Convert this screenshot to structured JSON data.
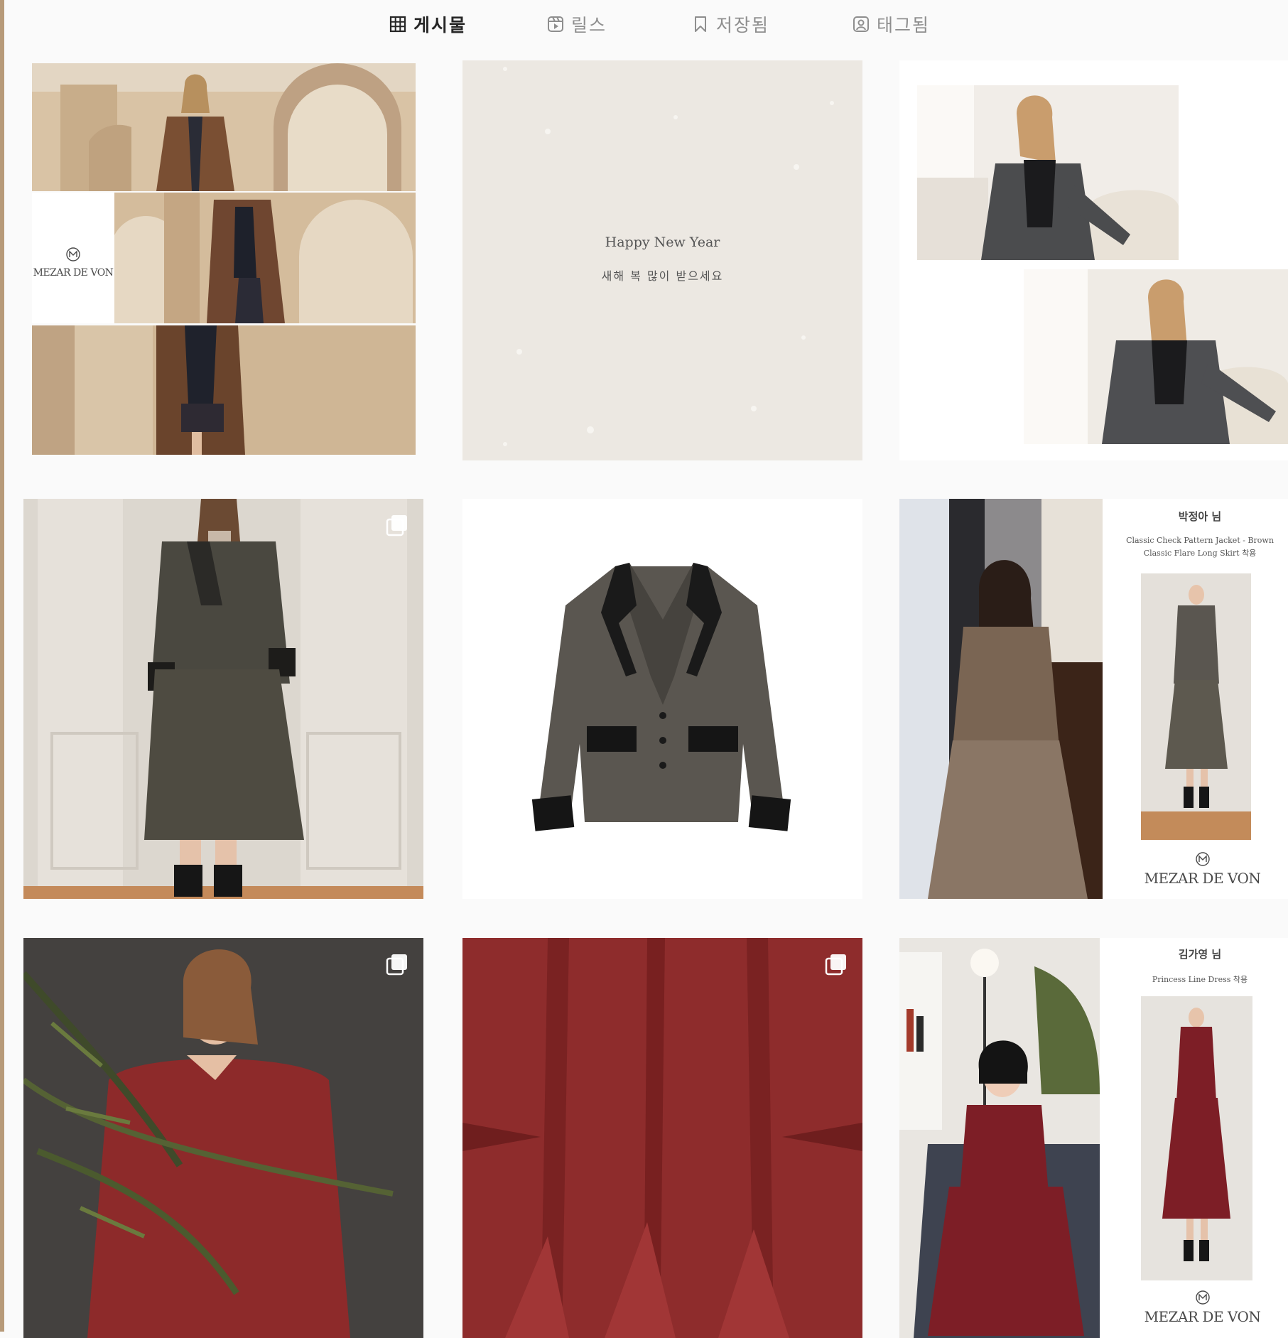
{
  "tabs": [
    {
      "label": "게시물",
      "icon": "grid-icon",
      "active": true
    },
    {
      "label": "릴스",
      "icon": "reels-icon",
      "active": false
    },
    {
      "label": "저장됨",
      "icon": "bookmark-icon",
      "active": false
    },
    {
      "label": "태그됨",
      "icon": "tagged-person-icon",
      "active": false
    }
  ],
  "posts": {
    "p1": {
      "brand": "MEZAR DE VON"
    },
    "p2": {
      "title": "Happy New Year",
      "subtitle": "새해 복 많이 받으세요"
    },
    "p6": {
      "name": "박정아 님",
      "desc_line1": "Classic Check Pattern Jacket - Brown",
      "desc_line2": "Classic Flare Long Skirt 착용",
      "brand": "MEZAR DE VON"
    },
    "p9": {
      "name": "김가영 님",
      "desc_line1": "Princess Line Dress 착용",
      "brand": "MEZAR DE VON"
    }
  },
  "colors": {
    "background": "#fafafa",
    "active_tab": "#262626",
    "inactive_tab": "#8e8e8e"
  }
}
